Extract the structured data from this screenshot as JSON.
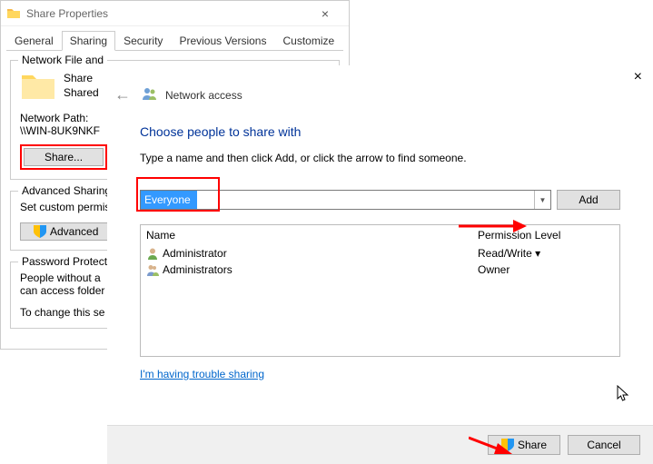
{
  "properties_dialog": {
    "title": "Share Properties",
    "tabs": {
      "general": "General",
      "sharing": "Sharing",
      "security": "Security",
      "previous": "Previous Versions",
      "customize": "Customize"
    },
    "network_group": {
      "legend": "Network File and",
      "share_name": "Share",
      "share_status": "Shared",
      "path_label": "Network Path:",
      "path_value": "\\\\WIN-8UK9NKF",
      "share_button": "Share..."
    },
    "advanced_group": {
      "legend": "Advanced Sharing",
      "description": "Set custom permis advanced sharing",
      "button": "Advanced"
    },
    "password_group": {
      "legend": "Password Protectio",
      "line1": "People without a",
      "line2": "can access folder",
      "line3": "To change this se"
    }
  },
  "network_access": {
    "header": "Network access",
    "title": "Choose people to share with",
    "instruction": "Type a name and then click Add, or click the arrow to find someone.",
    "input_value": "Everyone",
    "add_button": "Add",
    "columns": {
      "name": "Name",
      "perm": "Permission Level"
    },
    "rows": [
      {
        "name": "Administrator",
        "perm": "Read/Write ▾"
      },
      {
        "name": "Administrators",
        "perm": "Owner"
      }
    ],
    "trouble_link": "I'm having trouble sharing",
    "share_button": "Share",
    "cancel_button": "Cancel"
  }
}
